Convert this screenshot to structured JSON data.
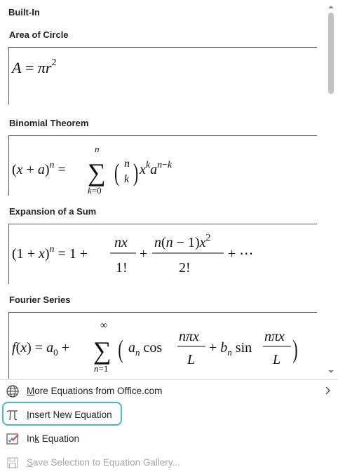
{
  "gallery": {
    "section_header": "Built-In",
    "equations": [
      {
        "title": "Area of Circle"
      },
      {
        "title": "Binomial Theorem"
      },
      {
        "title": "Expansion of a Sum"
      },
      {
        "title": "Fourier Series"
      }
    ]
  },
  "menu": {
    "items": [
      {
        "label_pre": "",
        "label_key": "M",
        "label_post": "ore Equations from Office.com",
        "icon": "globe-icon",
        "has_submenu": true,
        "disabled": false
      },
      {
        "label_pre": "",
        "label_key": "I",
        "label_post": "nsert New Equation",
        "icon": "pi-icon",
        "has_submenu": false,
        "disabled": false
      },
      {
        "label_pre": "In",
        "label_key": "k",
        "label_post": " Equation",
        "icon": "ink-equation-icon",
        "has_submenu": false,
        "disabled": false
      },
      {
        "label_pre": "",
        "label_key": "S",
        "label_post": "ave Selection to Equation Gallery...",
        "icon": "save-disk-icon",
        "has_submenu": false,
        "disabled": true
      }
    ]
  },
  "colors": {
    "highlight": "#3cc1c6",
    "scroll_thumb": "#c2c2c2",
    "disabled_text": "#a6a6a6"
  }
}
